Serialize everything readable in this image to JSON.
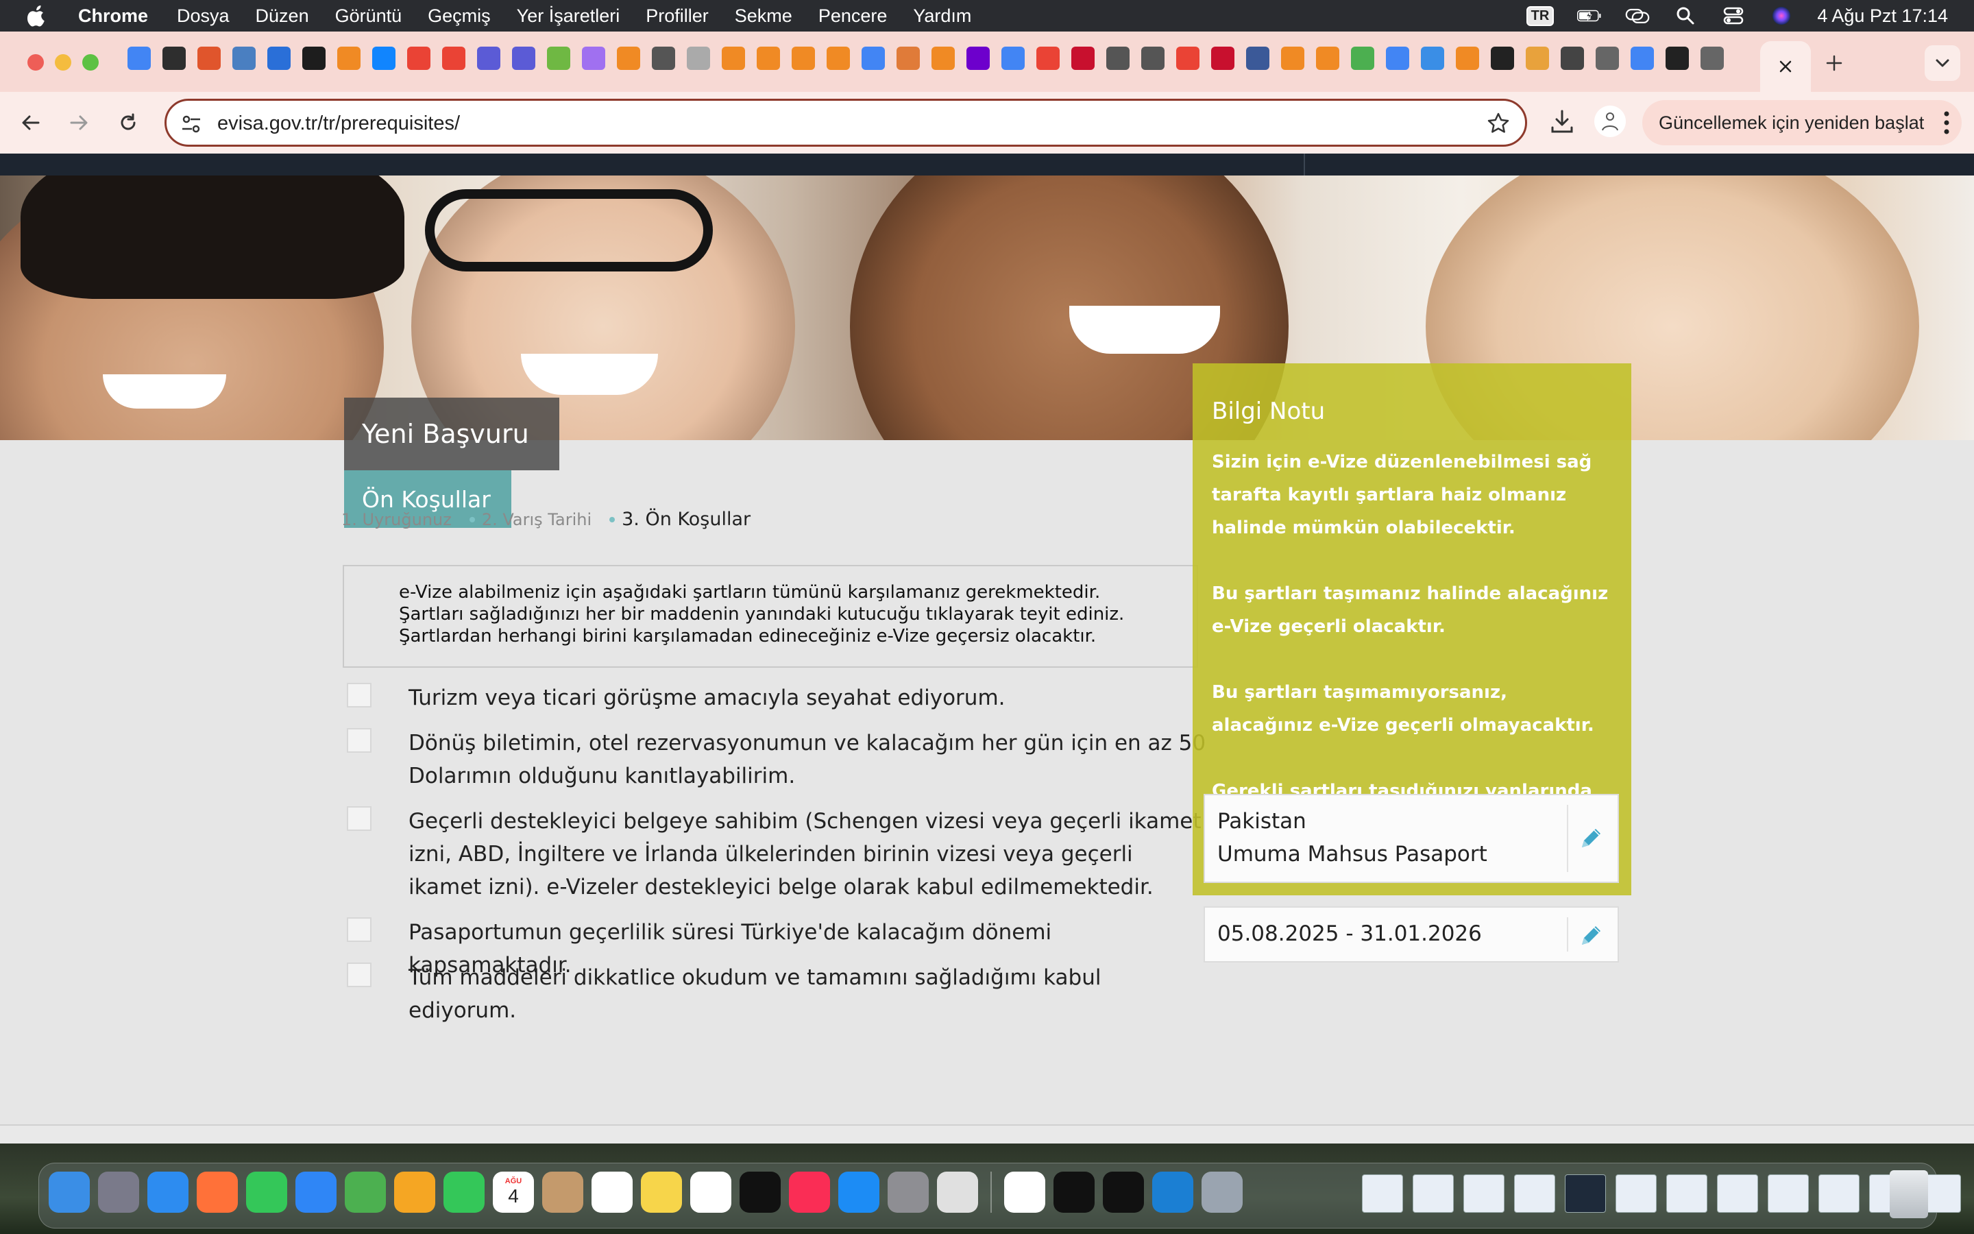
{
  "menubar": {
    "app_name": "Chrome",
    "items": [
      "Dosya",
      "Düzen",
      "Görüntü",
      "Geçmiş",
      "Yer İşaretleri",
      "Profiller",
      "Sekme",
      "Pencere",
      "Yardım"
    ],
    "input_source": "TR",
    "clock": "4 Ağu Pzt  17:14"
  },
  "browser": {
    "url": "evisa.gov.tr/tr/prerequisites/",
    "update_button": "Güncellemek için yeniden başlat"
  },
  "hero": {
    "title": "Yeni Başvuru",
    "subtitle": "Ön Koşullar"
  },
  "steps": [
    {
      "label": "1. Uyruğunuz",
      "state": "done"
    },
    {
      "label": "2. Varış Tarihi",
      "state": "done"
    },
    {
      "label": "3. Ön Koşullar",
      "state": "current"
    }
  ],
  "notice": "e-Vize alabilmeniz için aşağıdaki şartların tümünü karşılamanız gerekmektedir. Şartları sağladığınızı her bir maddenin yanındaki kutucuğu tıklayarak teyit ediniz. Şartlardan herhangi birini karşılamadan edineceğiniz e-Vize geçersiz olacaktır.",
  "conditions": [
    {
      "text": "Turizm veya ticari görüşme amacıyla seyahat ediyorum.",
      "checked": false
    },
    {
      "text": "Dönüş biletimin, otel rezervasyonumun ve kalacağım her gün için en az 50 Dolarımın olduğunu kanıtlayabilirim.",
      "checked": false
    },
    {
      "text": "Geçerli destekleyici belgeye sahibim (Schengen vizesi veya geçerli ikamet izni, ABD, İngiltere ve İrlanda ülkelerinden birinin vizesi veya geçerli ikamet izni). e-Vizeler destekleyici belge olarak kabul edilmemektedir.",
      "checked": false
    },
    {
      "text": "Pasaportumun geçerlilik süresi Türkiye'de kalacağım dönemi kapsamaktadır.",
      "checked": false
    },
    {
      "text": "Tüm maddeleri dikkatlice okudum ve tamamını sağladığımı kabul ediyorum.",
      "checked": false
    }
  ],
  "info": {
    "title": "Bilgi Notu",
    "paragraphs": [
      "Sizin için e-Vize düzenlenebilmesi sağ tarafta kayıtlı şartlara haiz olmanız halinde mümkün olabilecektir.",
      "Bu şartları taşımanız halinde alacağınız e-Vize geçerli olacaktır.",
      "Bu şartları taşımamıyorsanız, alacağınız e-Vize geçerli olmayacaktır.",
      "Gerekli şartları taşıdığınızı yanlarında bulunan kutucukları işaretleyerek teyit ediniz."
    ]
  },
  "summary": {
    "nationality": "Pakistan",
    "passport_type": "Umuma Mahsus Pasaport",
    "date_range": "05.08.2025 - 31.01.2026"
  },
  "colors": {
    "accent_teal": "#4da0a0",
    "info_panel": "#c0c028",
    "pencil": "#3fa7c9",
    "tab_strip": "#f7d9d4",
    "omnibox_border": "#8e3a2c"
  },
  "icons": {
    "tab_favicons": [
      "google-ads",
      "perplexity",
      "pages",
      "shield",
      "mountain",
      "zapier",
      "app",
      "bluesky",
      "gmail",
      "gmail",
      "s-app",
      "s-app",
      "jira",
      "gradient",
      "app",
      "github",
      "reddit",
      "app",
      "app",
      "app",
      "app",
      "google",
      "check",
      "app",
      "make",
      "google-ads",
      "gmail",
      "stop",
      "globe",
      "globe",
      "gmail",
      "app-red",
      "app",
      "app",
      "app",
      "grid",
      "google-ads",
      "puzzle",
      "app",
      "openai",
      "mail",
      "chess",
      "globe",
      "google",
      "openai",
      "globe"
    ],
    "dock": [
      "finder",
      "launchpad",
      "safari",
      "firefox",
      "messages",
      "mail",
      "maps",
      "photos",
      "facetime",
      "calendar",
      "contacts",
      "reminders",
      "notes",
      "freeform",
      "appletv",
      "music",
      "appstore",
      "system-settings",
      "iphone-mirroring",
      "chrome",
      "terminal",
      "cube",
      "vscode",
      "preview"
    ],
    "dock_calendar_day": "4",
    "dock_calendar_month": "AĞU"
  }
}
